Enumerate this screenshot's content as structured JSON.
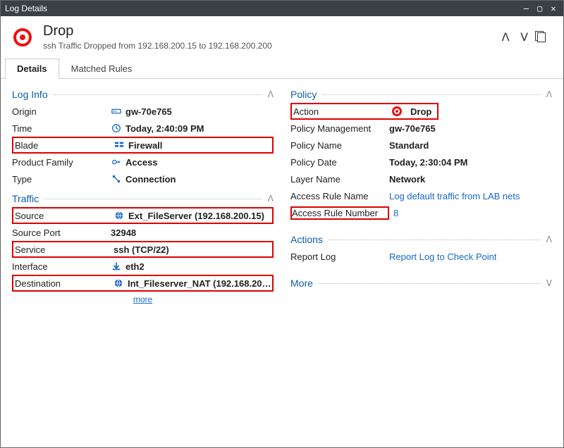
{
  "window": {
    "title": "Log Details"
  },
  "header": {
    "title": "Drop",
    "subtitle": "ssh Traffic Dropped from 192.168.200.15 to 192.168.200.200"
  },
  "tabs": {
    "details": "Details",
    "matched": "Matched Rules"
  },
  "logInfo": {
    "heading": "Log Info",
    "origin_k": "Origin",
    "origin_v": "gw-70e765",
    "time_k": "Time",
    "time_v": "Today, 2:40:09 PM",
    "blade_k": "Blade",
    "blade_v": "Firewall",
    "family_k": "Product Family",
    "family_v": "Access",
    "type_k": "Type",
    "type_v": "Connection"
  },
  "traffic": {
    "heading": "Traffic",
    "source_k": "Source",
    "source_v": "Ext_FileServer (192.168.200.15)",
    "sport_k": "Source Port",
    "sport_v": "32948",
    "service_k": "Service",
    "service_v": "ssh (TCP/22)",
    "iface_k": "Interface",
    "iface_v": "eth2",
    "dest_k": "Destination",
    "dest_v": "Int_Fileserver_NAT (192.168.200.20…",
    "more": "more"
  },
  "policy": {
    "heading": "Policy",
    "action_k": "Action",
    "action_v": "Drop",
    "mgmt_k": "Policy Management",
    "mgmt_v": "gw-70e765",
    "name_k": "Policy Name",
    "name_v": "Standard",
    "date_k": "Policy Date",
    "date_v": "Today, 2:30:04 PM",
    "layer_k": "Layer Name",
    "layer_v": "Network",
    "rule_name_k": "Access Rule Name",
    "rule_name_v": "Log default traffic from LAB nets",
    "rule_num_k": "Access Rule Number",
    "rule_num_v": "8"
  },
  "actions": {
    "heading": "Actions",
    "report_k": "Report Log",
    "report_v": "Report Log to Check Point"
  },
  "moreSection": {
    "heading": "More"
  }
}
